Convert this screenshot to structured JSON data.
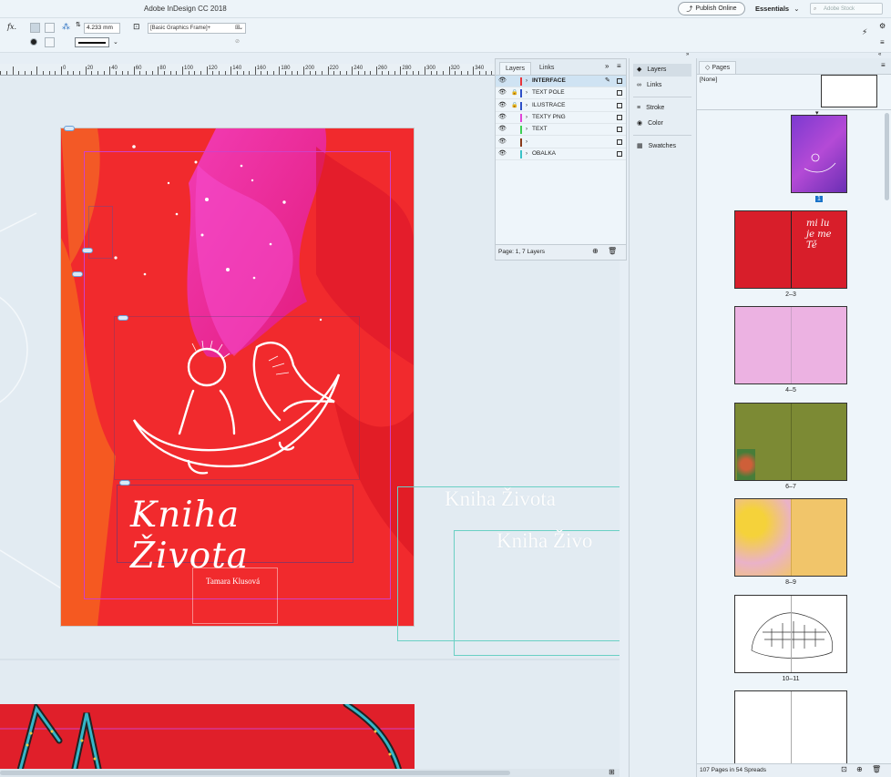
{
  "app": {
    "title": "Adobe InDesign CC 2018",
    "publish_label": "Publish Online",
    "workspace_label": "Essentials",
    "stock_search_placeholder": "Adobe Stock"
  },
  "control_bar": {
    "stroke_weight": "4.233 mm",
    "object_style": "[Basic Graphics Frame]+",
    "fx_label": "fx."
  },
  "ruler": {
    "labels": [
      "0",
      "20",
      "40",
      "60",
      "80",
      "100",
      "120",
      "140",
      "160",
      "180",
      "200",
      "220",
      "240",
      "260",
      "280",
      "300",
      "320",
      "340",
      "360"
    ]
  },
  "document": {
    "cover_title_script": "Kniha Života",
    "cover_author": "Tamara Klusová",
    "pasteboard_title_1": "Kniha Života",
    "pasteboard_title_2": "Kniha Živo"
  },
  "layers_panel": {
    "tabs": [
      "Layers",
      "Links"
    ],
    "layers": [
      {
        "name": "INTERFACE",
        "color": "#e8343a",
        "locked": false,
        "selected": true
      },
      {
        "name": "TEXT POLE",
        "color": "#2e50c8",
        "locked": true,
        "selected": false
      },
      {
        "name": "ILUSTRACE",
        "color": "#2e50c8",
        "locked": true,
        "selected": false
      },
      {
        "name": "TEXTY PNG",
        "color": "#e044d8",
        "locked": false,
        "selected": false
      },
      {
        "name": "TEXT",
        "color": "#3fcf55",
        "locked": false,
        "selected": false
      },
      {
        "name": "",
        "color": "#8a3a1a",
        "locked": false,
        "selected": false
      },
      {
        "name": "OBALKA",
        "color": "#3ac2c8",
        "locked": false,
        "selected": false
      }
    ],
    "footer": "Page: 1, 7 Layers"
  },
  "dock": {
    "items": [
      "Layers",
      "Links",
      "Stroke",
      "Color",
      "Swatches"
    ]
  },
  "pages_panel": {
    "tab": "Pages",
    "master_label": "[None]",
    "first_page_number": "1",
    "spread_labels": [
      "2–3",
      "4–5",
      "6–7",
      "8–9",
      "10–11"
    ],
    "footer": "107 Pages in 54 Spreads",
    "spread2_right_text": "mi lu je me Tě"
  },
  "colors": {
    "accent": "#1a73c9",
    "cover_red": "#f02a2e",
    "magenta": "#e8208a",
    "frame_guide": "#d040c8",
    "text_frame": "#3ac2a8"
  }
}
